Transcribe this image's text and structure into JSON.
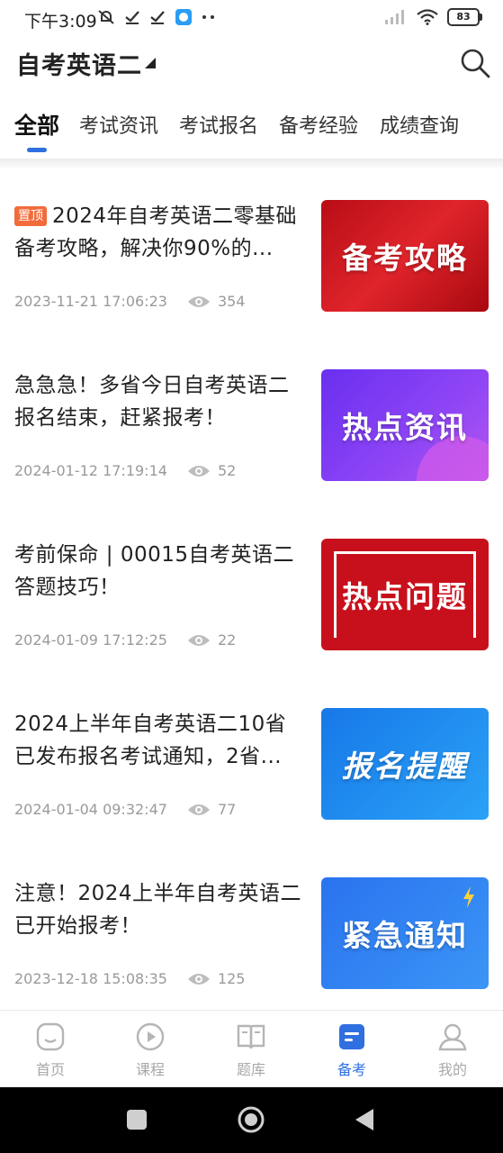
{
  "status_bar": {
    "time": "下午3:09",
    "battery": "83",
    "icons": [
      "mute-icon",
      "check-icon",
      "check-icon",
      "app-notification-icon",
      "more-dots-icon",
      "signal-icon",
      "wifi-icon",
      "battery-icon"
    ]
  },
  "header": {
    "title": "自考英语二",
    "search_icon": "search-icon"
  },
  "tabs": [
    {
      "label": "全部",
      "active": true
    },
    {
      "label": "考试资讯",
      "active": false
    },
    {
      "label": "考试报名",
      "active": false
    },
    {
      "label": "备考经验",
      "active": false
    },
    {
      "label": "成绩查询",
      "active": false
    }
  ],
  "articles": [
    {
      "pinned_label": "置顶",
      "title": "2024年自考英语二零基础备考攻略，解决你90%的...",
      "date": "2023-11-21 17:06:23",
      "views": "354",
      "thumb_text": "备考攻略",
      "thumb_color": "#d4151f"
    },
    {
      "title": "急急急！多省今日自考英语二报名结束，赶紧报考！",
      "date": "2024-01-12 17:19:14",
      "views": "52",
      "thumb_text": "热点资讯",
      "thumb_color": "#7a3ff0"
    },
    {
      "title": "考前保命 | 00015自考英语二答题技巧！",
      "date": "2024-01-09 17:12:25",
      "views": "22",
      "thumb_text": "热点问题",
      "thumb_color": "#c8101c"
    },
    {
      "title": "2024上半年自考英语二10省已发布报名考试通知，2省...",
      "date": "2024-01-04 09:32:47",
      "views": "77",
      "thumb_text": "报名提醒",
      "thumb_color": "#1f8ef0"
    },
    {
      "title": "注意！2024上半年自考英语二已开始报考！",
      "date": "2023-12-18 15:08:35",
      "views": "125",
      "thumb_text": "紧急通知",
      "thumb_color": "#2b7ff2"
    }
  ],
  "bottom_nav": [
    {
      "label": "首页",
      "icon": "home-icon",
      "active": false
    },
    {
      "label": "课程",
      "icon": "play-icon",
      "active": false
    },
    {
      "label": "题库",
      "icon": "book-icon",
      "active": false
    },
    {
      "label": "备考",
      "icon": "prep-icon",
      "active": true
    },
    {
      "label": "我的",
      "icon": "profile-icon",
      "active": false
    }
  ],
  "colors": {
    "accent": "#2f6fe0",
    "pin_badge": "#f26b3a",
    "meta_text": "#9a9a9a"
  }
}
